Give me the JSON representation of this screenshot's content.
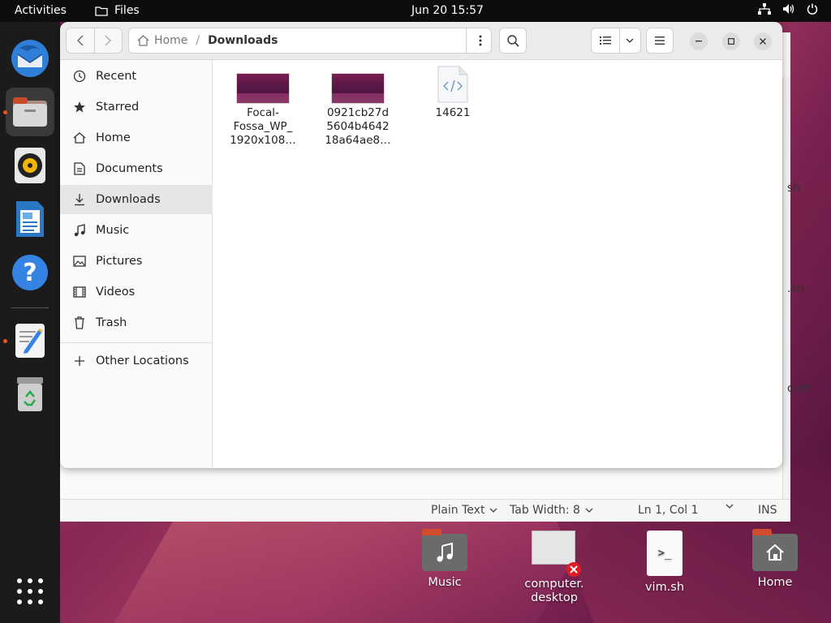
{
  "topbar": {
    "activities": "Activities",
    "app_name": "Files",
    "clock": "Jun 20  15:57"
  },
  "dock": {
    "items": [
      "thunderbird-icon",
      "files-icon",
      "rhythmbox-icon",
      "writer-icon",
      "help-icon",
      "text-editor-icon",
      "trash-icon",
      "app-grid-icon"
    ]
  },
  "files_window": {
    "path": {
      "home": "Home",
      "separator": "/",
      "current": "Downloads"
    },
    "sidebar": [
      {
        "label": "Recent",
        "icon": "clock-icon"
      },
      {
        "label": "Starred",
        "icon": "star-icon"
      },
      {
        "label": "Home",
        "icon": "home-icon"
      },
      {
        "label": "Documents",
        "icon": "document-icon"
      },
      {
        "label": "Downloads",
        "icon": "download-icon",
        "selected": true
      },
      {
        "label": "Music",
        "icon": "music-icon"
      },
      {
        "label": "Pictures",
        "icon": "picture-icon"
      },
      {
        "label": "Videos",
        "icon": "video-icon"
      },
      {
        "label": "Trash",
        "icon": "trash-icon"
      },
      {
        "label": "Other Locations",
        "icon": "plus-icon"
      }
    ],
    "files": [
      {
        "line1": "Focal-",
        "line2": "Fossa_WP_",
        "line3": "1920x108…",
        "type": "image"
      },
      {
        "line1": "0921cb27d",
        "line2": "5604b4642",
        "line3": "18a64ae8…",
        "type": "image"
      },
      {
        "line1": "14621",
        "type": "code"
      }
    ]
  },
  "editor_status": {
    "language": "Plain Text",
    "tab_width": "Tab Width: 8",
    "position": "Ln 1, Col 1",
    "mode": "INS"
  },
  "editor_peek": [
    "sh",
    ".sh",
    "o.sh"
  ],
  "desktop_icons": [
    {
      "label": "Music"
    },
    {
      "label1": "computer.",
      "label2": "desktop"
    },
    {
      "label": "vim.sh"
    },
    {
      "label": "Home"
    }
  ]
}
